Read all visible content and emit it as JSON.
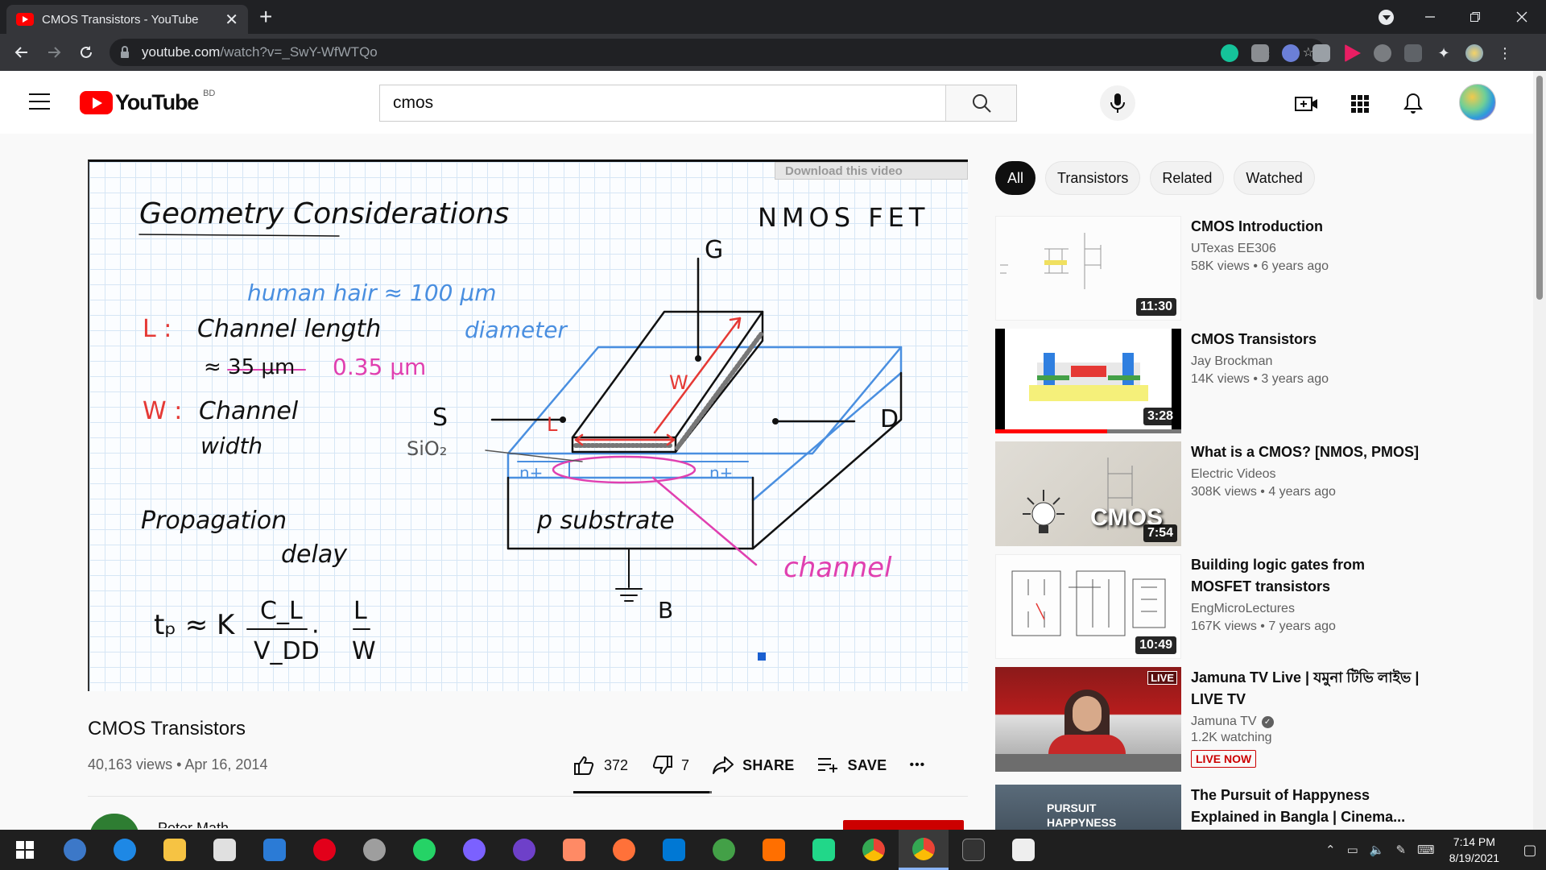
{
  "browser": {
    "tab_title": "CMOS Transistors - YouTube",
    "tab_close": "✕",
    "new_tab": "+",
    "url_host": "youtube.com",
    "url_path": "/watch?v=_SwY-WfWTQo"
  },
  "youtube": {
    "logo_text": "YouTube",
    "country_code": "BD",
    "search_value": "cmos",
    "search_placeholder": "Search"
  },
  "video": {
    "title": "CMOS Transistors",
    "views_and_date": "40,163 views • Apr 16, 2014",
    "likes": "372",
    "dislikes": "7",
    "share_label": "SHARE",
    "save_label": "SAVE",
    "more_label": "•••",
    "like_ratio": 0.98,
    "channel_name_peek": "Peter Math",
    "download_overlay": "Download this video"
  },
  "whiteboard": {
    "heading": "Geometry Considerations",
    "nmos": "NMOS FET",
    "hair": "human hair ≈ 100 μm",
    "diameter": "diameter",
    "l_label": "L :",
    "l_text": "Channel length",
    "l_value_old": "≈ 35 μm",
    "l_value_new": "0.35 μm",
    "w_label": "W :",
    "w_text1": "Channel",
    "w_text2": "width",
    "prop1": "Propagation",
    "prop2": "delay",
    "formula": "tₚ ≈ K",
    "cl": "C_L",
    "vdd": "V_DD",
    "frac_l": "L",
    "frac_w": "W",
    "g": "G",
    "s": "S",
    "d": "D",
    "b": "B",
    "w_arrow": "W",
    "l_arrow": "L",
    "sio2": "SiO₂",
    "nplus_left": "n+",
    "nplus_right": "n+",
    "substrate": "p substrate",
    "channel": "channel"
  },
  "sidebar": {
    "chips": [
      "All",
      "Transistors",
      "Related",
      "Watched"
    ],
    "recommendations": [
      {
        "title": "CMOS Introduction",
        "channel": "UTexas EE306",
        "stats": "58K views • 6 years ago",
        "duration": "11:30"
      },
      {
        "title": "CMOS Transistors",
        "channel": "Jay Brockman",
        "stats": "14K views • 3 years ago",
        "duration": "3:28",
        "watched_fraction": 0.6
      },
      {
        "title": "What is a CMOS? [NMOS, PMOS]",
        "channel": "Electric Videos",
        "stats": "308K views • 4 years ago",
        "duration": "7:54",
        "thumb_text": "CMOS"
      },
      {
        "title": "Building logic gates from MOSFET transistors",
        "channel": "EngMicroLectures",
        "stats": "167K views • 7 years ago",
        "duration": "10:49"
      },
      {
        "title": "Jamuna TV Live | যমুনা টিভি লাইভ | LIVE TV",
        "channel": "Jamuna TV",
        "stats": "1.2K watching",
        "badge": "LIVE NOW",
        "thumb_tag": "LIVE"
      },
      {
        "title": "The Pursuit of Happyness Explained in Bangla | Cinema...",
        "thumb_text": "PURSUIT HAPPYNESS"
      }
    ]
  },
  "taskbar": {
    "time": "7:14 PM",
    "date": "8/19/2021"
  },
  "colors": {
    "yt_red": "#ff0000",
    "ink_red": "#e53935",
    "ink_blue": "#4a8fe0",
    "ink_magenta": "#e040b0"
  }
}
